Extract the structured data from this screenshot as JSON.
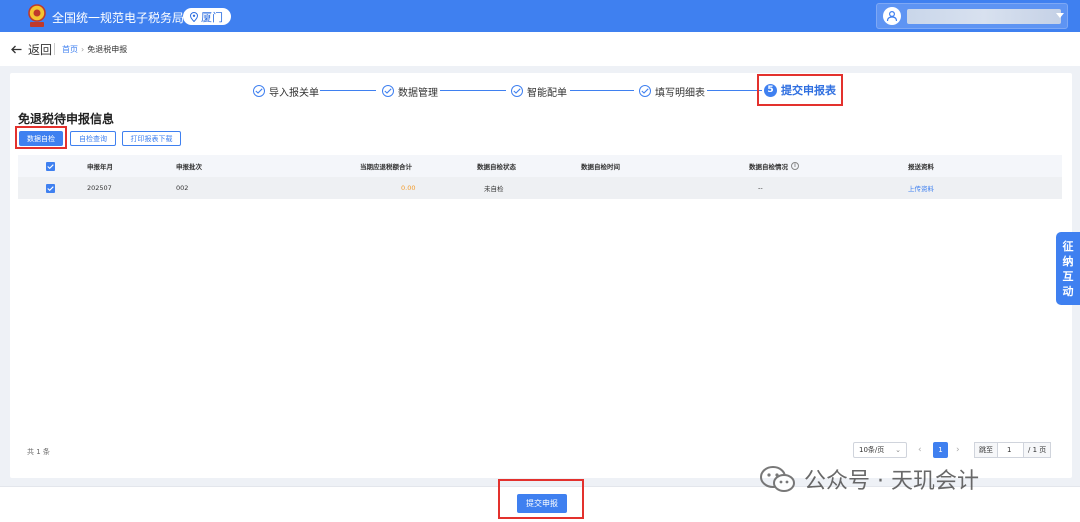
{
  "header": {
    "site_title": "全国统一规范电子税务局",
    "city": "厦门",
    "username": ""
  },
  "subbar": {
    "back_label": "返回",
    "breadcrumb_home": "首页",
    "breadcrumb_current": "免退税申报"
  },
  "steps": [
    {
      "label": "导入报关单",
      "status": "done"
    },
    {
      "label": "数据管理",
      "status": "done"
    },
    {
      "label": "智能配单",
      "status": "done"
    },
    {
      "label": "填写明细表",
      "status": "done"
    },
    {
      "label": "提交申报表",
      "number": "5",
      "status": "active"
    }
  ],
  "section_title": "免退税待申报信息",
  "toolbar": {
    "self_check": "数据自检",
    "check_query": "自检查询",
    "print_download": "打印报表下载"
  },
  "table": {
    "headers": [
      "申报年月",
      "申报批次",
      "当期应退税额合计",
      "数据自检状态",
      "数据自检时间",
      "数据自检情况",
      "报送资料"
    ],
    "rows": [
      {
        "period": "202507",
        "batch": "002",
        "refund_total": "0.00",
        "check_status": "未自检",
        "check_time": "",
        "check_result": "--",
        "docs": "上传资料",
        "selected": true
      }
    ],
    "header_selected": true
  },
  "pagination": {
    "total_text": "共 1 条",
    "page_size": "10条/页",
    "current_page": "1",
    "goto_label": "跳至",
    "goto_value": "1",
    "total_pages": "/ 1 页"
  },
  "side_tab": [
    "征",
    "纳",
    "互",
    "动"
  ],
  "footer": {
    "submit_label": "提交申报"
  },
  "watermark": {
    "text": "公众号 · 天玑会计"
  },
  "colors": {
    "brand_blue": "#3f80f0",
    "highlight_red": "#e3312d",
    "amount_orange": "#f39b2a"
  }
}
